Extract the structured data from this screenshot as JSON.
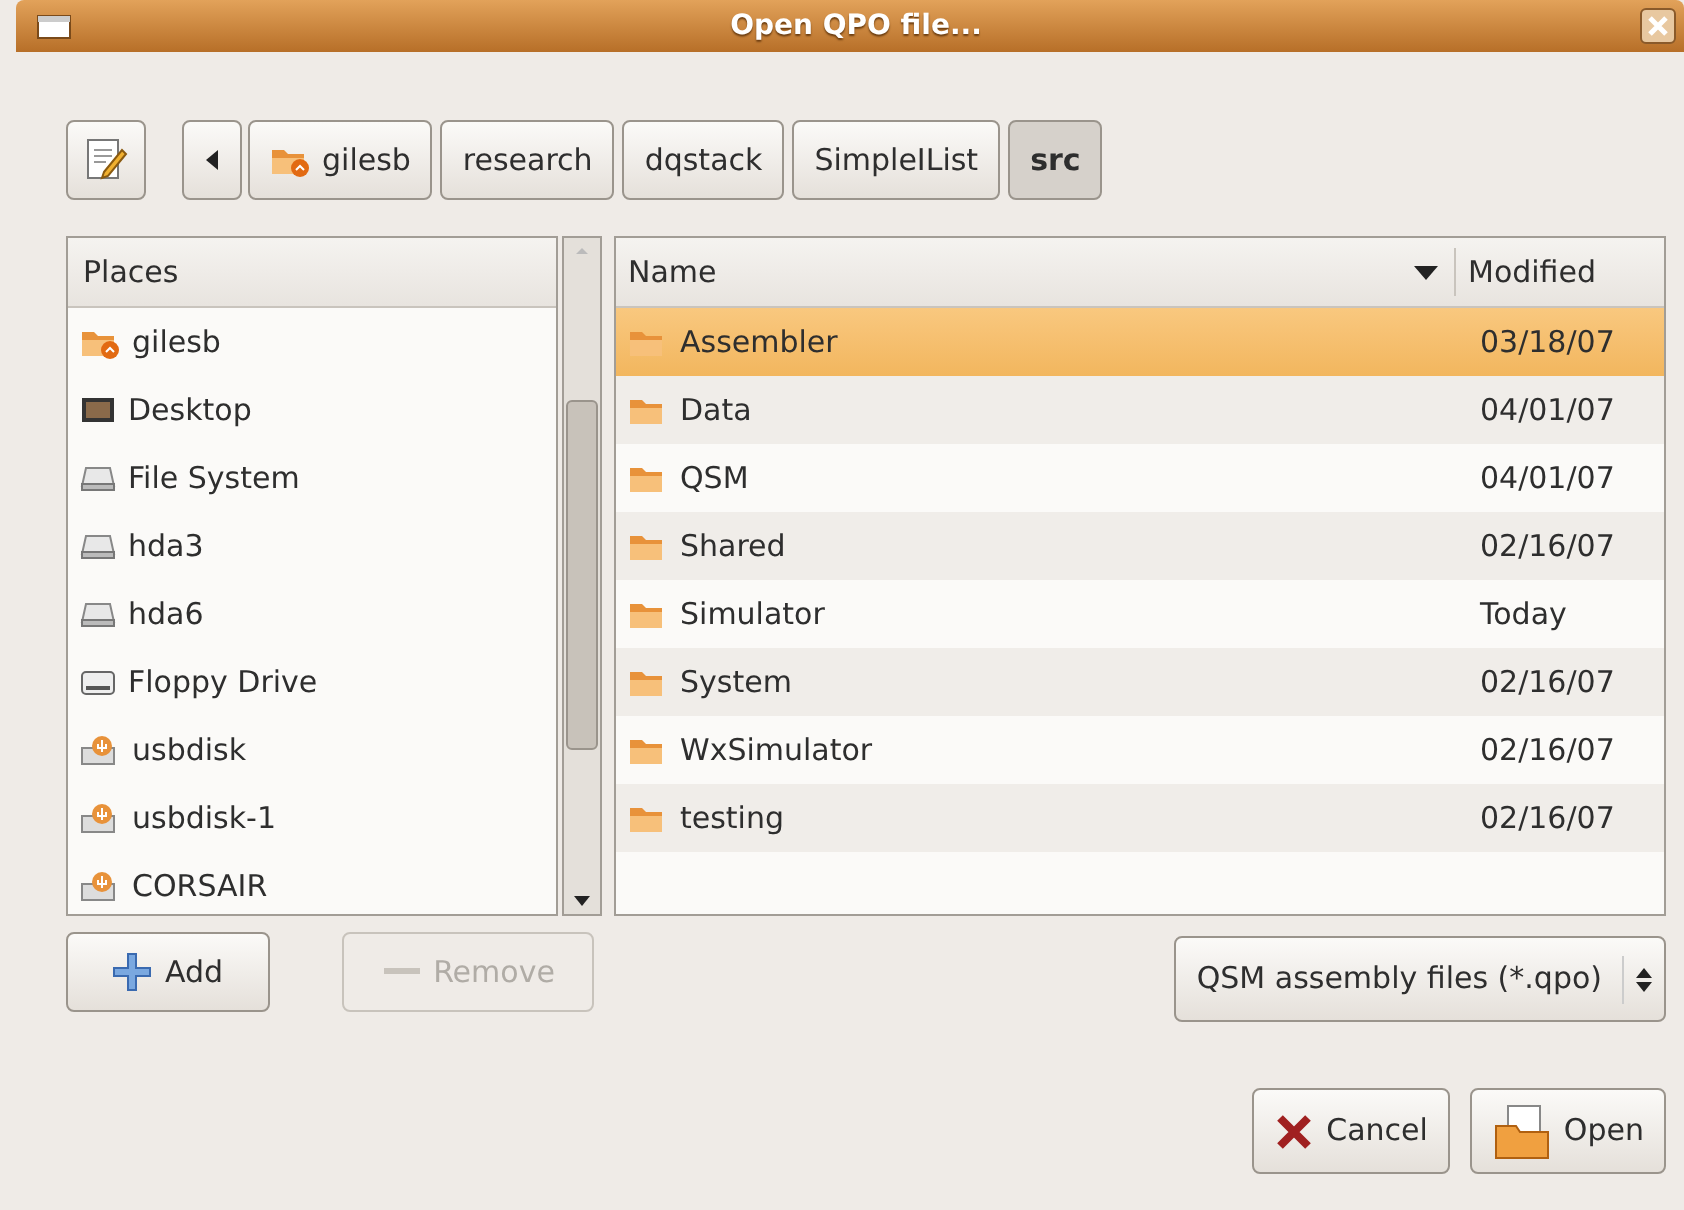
{
  "window": {
    "title": "Open QPO file..."
  },
  "path_bar": {
    "segments": [
      {
        "label": "gilesb",
        "kind": "home",
        "selected": false
      },
      {
        "label": "research",
        "kind": "folder",
        "selected": false
      },
      {
        "label": "dqstack",
        "kind": "folder",
        "selected": false
      },
      {
        "label": "SimpleIList",
        "kind": "folder",
        "selected": false
      },
      {
        "label": "src",
        "kind": "folder",
        "selected": true
      }
    ]
  },
  "places": {
    "heading": "Places",
    "items": [
      {
        "label": "gilesb",
        "kind": "home"
      },
      {
        "label": "Desktop",
        "kind": "desktop"
      },
      {
        "label": "File System",
        "kind": "drive"
      },
      {
        "label": "hda3",
        "kind": "drive"
      },
      {
        "label": "hda6",
        "kind": "drive"
      },
      {
        "label": "Floppy Drive",
        "kind": "floppy"
      },
      {
        "label": "usbdisk",
        "kind": "usb"
      },
      {
        "label": "usbdisk-1",
        "kind": "usb"
      },
      {
        "label": "CORSAIR",
        "kind": "usb"
      }
    ],
    "add_button": {
      "label": "Add",
      "disabled": false
    },
    "remove_button": {
      "label": "Remove",
      "disabled": true
    }
  },
  "files": {
    "columns": [
      "Name",
      "Modified"
    ],
    "rows": [
      {
        "name": "Assembler",
        "modified": "03/18/07",
        "selected": true
      },
      {
        "name": "Data",
        "modified": "04/01/07",
        "selected": false
      },
      {
        "name": "QSM",
        "modified": "04/01/07",
        "selected": false
      },
      {
        "name": "Shared",
        "modified": "02/16/07",
        "selected": false
      },
      {
        "name": "Simulator",
        "modified": "Today",
        "selected": false
      },
      {
        "name": "System",
        "modified": "02/16/07",
        "selected": false
      },
      {
        "name": "WxSimulator",
        "modified": "02/16/07",
        "selected": false
      },
      {
        "name": "testing",
        "modified": "02/16/07",
        "selected": false
      }
    ]
  },
  "filter": {
    "value": "QSM assembly files (*.qpo)"
  },
  "buttons": [
    {
      "label": "Cancel",
      "kind": "cancel"
    },
    {
      "label": "Open",
      "kind": "open"
    }
  ]
}
